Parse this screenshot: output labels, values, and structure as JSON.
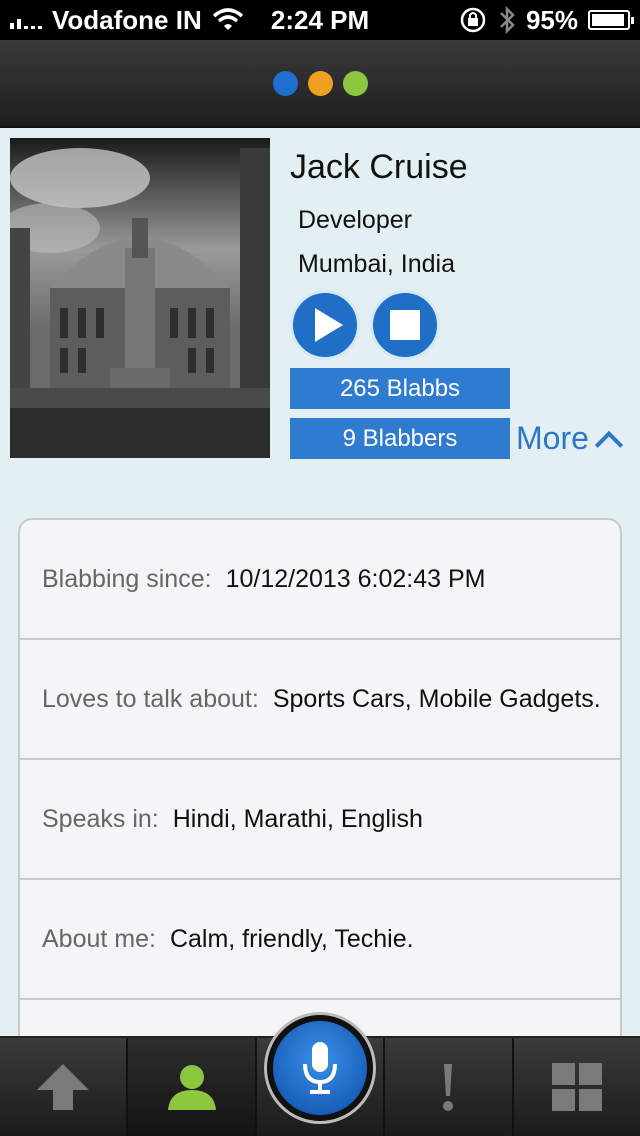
{
  "status_bar": {
    "carrier": "Vodafone IN",
    "time": "2:24 PM",
    "battery": "95%"
  },
  "header": {
    "dots": [
      "#1e6fd0",
      "#f0a020",
      "#8dc63f"
    ]
  },
  "profile": {
    "name": "Jack Cruise",
    "role": "Developer",
    "location": "Mumbai, India",
    "blabbs": "265 Blabbs",
    "blabbers": "9 Blabbers",
    "more": "More"
  },
  "info": [
    {
      "label": "Blabbing since:",
      "value": "10/12/2013 6:02:43 PM"
    },
    {
      "label": "Loves to talk about:",
      "value": "Sports Cars, Mobile Gadgets."
    },
    {
      "label": "Speaks in:",
      "value": "Hindi, Marathi, English"
    },
    {
      "label": "About me:",
      "value": "Calm, friendly, Techie."
    }
  ],
  "tabs": [
    "arrow-up-icon",
    "user-icon",
    "microphone-icon",
    "exclamation-icon",
    "grid-icon"
  ],
  "colors": {
    "accent": "#2f7bd0",
    "active_tab_icon": "#8dc63f"
  }
}
